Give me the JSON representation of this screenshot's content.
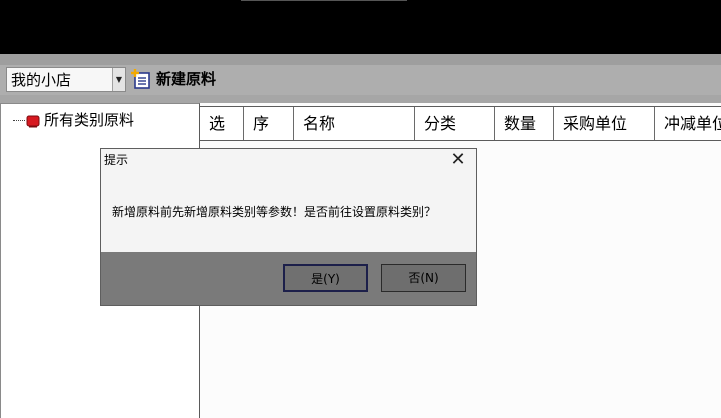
{
  "toolbar": {
    "store_selected": "我的小店",
    "new_material_label": "新建原料"
  },
  "tree": {
    "root_label": "所有类别原料"
  },
  "grid": {
    "columns": [
      "选",
      "序",
      "名称",
      "分类",
      "数量",
      "采购单位",
      "冲减单位"
    ]
  },
  "dialog": {
    "title": "提示",
    "message": "新增原料前先新增原料类别等参数！是否前往设置原料类别？",
    "yes_label": "是(Y)",
    "no_label": "否(N)"
  },
  "icons": {
    "store_dropdown": "chevron-down-icon",
    "new_material": "document-add-icon",
    "tree_root": "folder-icon",
    "dialog_close": "close-icon"
  },
  "colors": {
    "tree_icon": "#d71920",
    "new_icon_plus": "#f2a900",
    "new_icon_doc": "#2b3a8c"
  }
}
